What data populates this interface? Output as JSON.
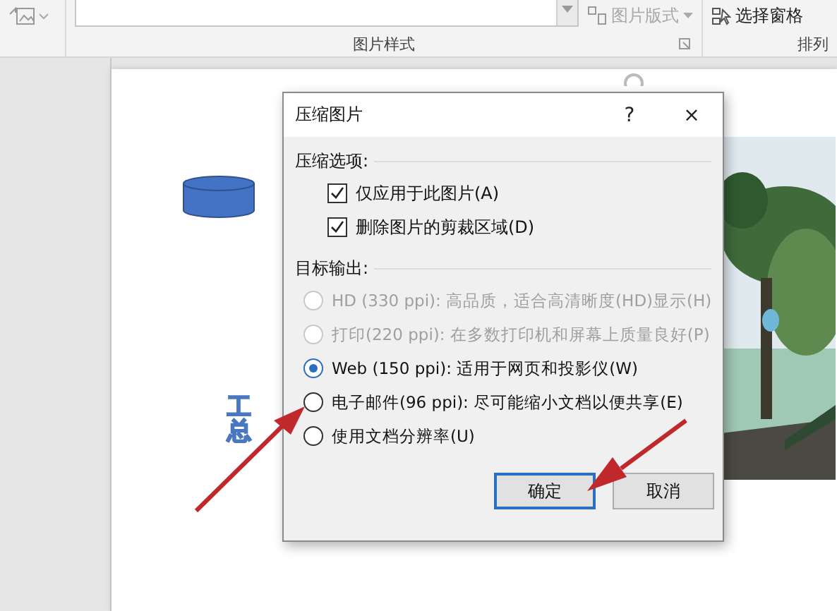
{
  "ribbon": {
    "layout_button": {
      "label": "图片版式",
      "disabled": true
    },
    "pane_button": {
      "label": "选择窗格"
    },
    "groups": [
      {
        "label": "图片样式"
      },
      {
        "label": "排列"
      }
    ]
  },
  "slide": {
    "text_lines": [
      "工",
      "总"
    ]
  },
  "dialog": {
    "title": "压缩图片",
    "help": "?",
    "close": "×",
    "compress_section": "压缩选项:",
    "checkboxes": [
      {
        "label": "仅应用于此图片(A)",
        "checked": true
      },
      {
        "label": "删除图片的剪裁区域(D)",
        "checked": true
      }
    ],
    "output_section": "目标输出:",
    "options": [
      {
        "label": "HD (330 ppi): 高品质，适合高清晰度(HD)显示(H)",
        "selected": false,
        "disabled": true
      },
      {
        "label": "打印(220 ppi): 在多数打印机和屏幕上质量良好(P)",
        "selected": false,
        "disabled": true
      },
      {
        "label": "Web (150 ppi): 适用于网页和投影仪(W)",
        "selected": true,
        "disabled": false
      },
      {
        "label": "电子邮件(96 ppi): 尽可能缩小文档以便共享(E)",
        "selected": false,
        "disabled": false
      },
      {
        "label": "使用文档分辨率(U)",
        "selected": false,
        "disabled": false
      }
    ],
    "buttons": [
      {
        "label": "确定",
        "selected": true
      },
      {
        "label": "取消",
        "selected": false
      }
    ]
  }
}
